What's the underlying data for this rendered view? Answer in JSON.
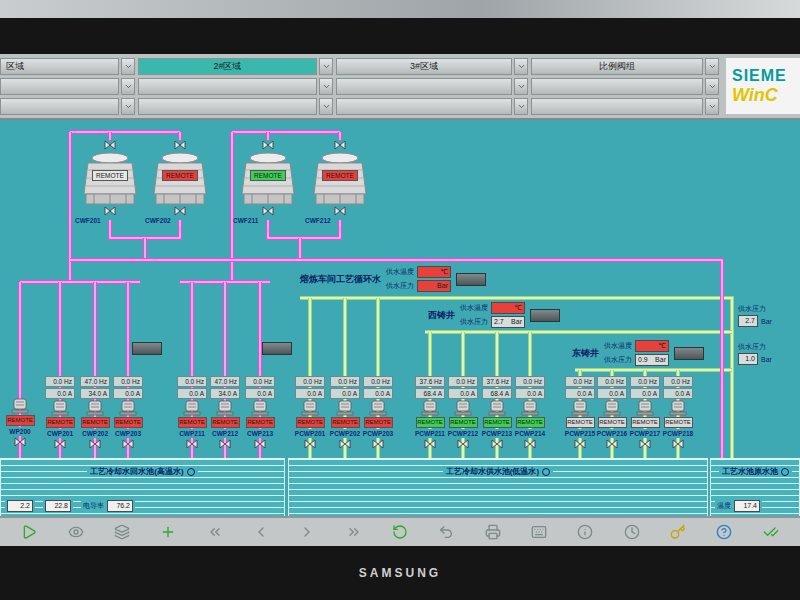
{
  "nav": {
    "tabs": [
      {
        "label": "区域",
        "selected": false
      },
      {
        "label": "2#区域",
        "selected": true
      },
      {
        "label": "3#区域",
        "selected": false
      },
      {
        "label": "比例阀组",
        "selected": false
      }
    ],
    "logo": {
      "brand": "SIEME",
      "product": "WinC"
    }
  },
  "towers": [
    {
      "label": "CWF201",
      "status": "REMOTE",
      "color": "#e6e6e6"
    },
    {
      "label": "CWF202",
      "status": "REMOTE",
      "color": "#e8413c"
    },
    {
      "label": "CWF211",
      "status": "REMOTE",
      "color": "#3ccf55"
    },
    {
      "label": "CWF212",
      "status": "REMOTE",
      "color": "#e8413c"
    }
  ],
  "headers": [
    {
      "title": "熔炼车间工艺循环水",
      "rows": [
        {
          "label": "供水温度",
          "value": "",
          "unit": "℃",
          "alarm": true
        },
        {
          "label": "供水压力",
          "value": "",
          "unit": "Bar",
          "alarm": true
        }
      ]
    },
    {
      "title": "西铸井",
      "rows": [
        {
          "label": "供水温度",
          "value": "",
          "unit": "℃",
          "alarm": true
        },
        {
          "label": "供水压力",
          "value": "2.7",
          "unit": "Bar",
          "alarm": false
        }
      ]
    },
    {
      "title": "东铸井",
      "rows": [
        {
          "label": "供水温度",
          "value": "",
          "unit": "℃",
          "alarm": true
        },
        {
          "label": "供水压力",
          "value": "0.9",
          "unit": "Bar",
          "alarm": false
        }
      ]
    }
  ],
  "branch_readings": [
    {
      "label": "供水压力",
      "value": "2.7",
      "unit": "Bar"
    },
    {
      "label": "供水压力",
      "value": "1.0",
      "unit": "Bar"
    }
  ],
  "pump_groups": [
    {
      "pumps": [
        {
          "id": "WP200",
          "hz": "",
          "amps": "",
          "status": "REMOTE",
          "color": "#e8413c"
        },
        {
          "id": "CWP201",
          "hz": "0.0 Hz",
          "amps": "0.0 A",
          "status": "REMOTE",
          "color": "#e8413c"
        },
        {
          "id": "CWP202",
          "hz": "47.0 Hz",
          "amps": "34.0 A",
          "status": "REMOTE",
          "color": "#e8413c"
        },
        {
          "id": "CWP203",
          "hz": "0.0 Hz",
          "amps": "0.0 A",
          "status": "REMOTE",
          "color": "#e8413c"
        }
      ]
    },
    {
      "pumps": [
        {
          "id": "CWP211",
          "hz": "0.0 Hz",
          "amps": "0.0 A",
          "status": "REMOTE",
          "color": "#e8413c"
        },
        {
          "id": "CWP212",
          "hz": "47.0 Hz",
          "amps": "34.0 A",
          "status": "REMOTE",
          "color": "#e8413c"
        },
        {
          "id": "CWP213",
          "hz": "0.0 Hz",
          "amps": "0.0 A",
          "status": "REMOTE",
          "color": "#e8413c"
        }
      ]
    },
    {
      "pumps": [
        {
          "id": "PCWP201",
          "hz": "0.0 Hz",
          "amps": "0.0 A",
          "status": "REMOTE",
          "color": "#e8413c"
        },
        {
          "id": "PCWP202",
          "hz": "0.0 Hz",
          "amps": "0.0 A",
          "status": "REMOTE",
          "color": "#e8413c"
        },
        {
          "id": "PCWP203",
          "hz": "0.0 Hz",
          "amps": "0.0 A",
          "status": "REMOTE",
          "color": "#e8413c"
        }
      ]
    },
    {
      "pumps": [
        {
          "id": "PCWP211",
          "hz": "37.6 Hz",
          "amps": "68.4 A",
          "status": "REMOTE",
          "color": "#3ccf55"
        },
        {
          "id": "PCWP212",
          "hz": "0.0 Hz",
          "amps": "0.0 A",
          "status": "REMOTE",
          "color": "#3ccf55"
        },
        {
          "id": "PCWP213",
          "hz": "37.6 Hz",
          "amps": "68.4 A",
          "status": "REMOTE",
          "color": "#3ccf55"
        },
        {
          "id": "PCWP214",
          "hz": "0.0 Hz",
          "amps": "0.0 A",
          "status": "REMOTE",
          "color": "#3ccf55"
        }
      ]
    },
    {
      "pumps": [
        {
          "id": "PCWP215",
          "hz": "0.0 Hz",
          "amps": "0.0 A",
          "status": "REMOTE",
          "color": "#d9d9d9"
        },
        {
          "id": "PCWP216",
          "hz": "0.0 Hz",
          "amps": "0.0 A",
          "status": "REMOTE",
          "color": "#d9d9d9"
        },
        {
          "id": "PCWP217",
          "hz": "0.0 Hz",
          "amps": "0.0 A",
          "status": "REMOTE",
          "color": "#d9d9d9"
        },
        {
          "id": "PCWP218",
          "hz": "0.0 Hz",
          "amps": "0.0 A",
          "status": "REMOTE",
          "color": "#d9d9d9"
        }
      ]
    }
  ],
  "tanks": [
    {
      "label": "工艺冷却水回水池(高温水)",
      "fields": [
        {
          "value": "2.2"
        },
        {
          "value": "22.8"
        },
        {
          "label": "电导率",
          "value": "76.2"
        }
      ]
    },
    {
      "label": "工艺冷却水供水池(低温水)",
      "fields": []
    },
    {
      "label": "工艺水池原水池",
      "fields": [
        {
          "label": "温度",
          "value": "17.4"
        }
      ]
    }
  ],
  "monitor": {
    "brand": "SAMSUNG"
  }
}
